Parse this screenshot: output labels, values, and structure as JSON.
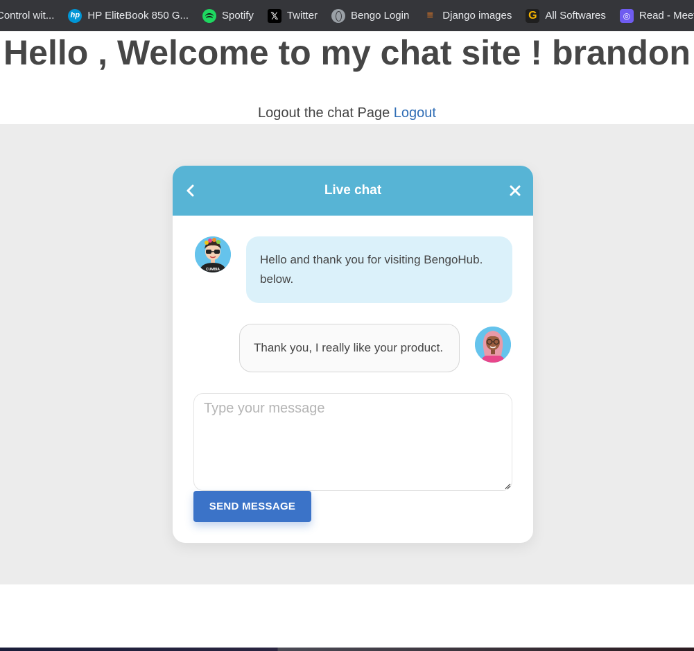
{
  "bookmarks": [
    {
      "label": "Control wit...",
      "icon": "none"
    },
    {
      "label": "HP EliteBook 850 G...",
      "icon": "hp-icon",
      "glyph": "hp"
    },
    {
      "label": "Spotify",
      "icon": "spotify-icon",
      "glyph": ""
    },
    {
      "label": "Twitter",
      "icon": "x-icon",
      "glyph": "𝕏"
    },
    {
      "label": "Bengo Login",
      "icon": "globe-icon",
      "glyph": ""
    },
    {
      "label": "Django images",
      "icon": "stackoverflow-icon",
      "glyph": "≡"
    },
    {
      "label": "All Softwares",
      "icon": "g-icon",
      "glyph": "G"
    },
    {
      "label": "Read - Meeting",
      "icon": "read-icon",
      "glyph": "◎"
    }
  ],
  "header": {
    "welcome": "Hello , Welcome to my chat site ! brandon",
    "logout_text": "Logout the chat Page",
    "logout_link": "Logout"
  },
  "chat": {
    "title": "Live chat",
    "messages": [
      {
        "from": "agent",
        "text": "Hello and thank you for visiting BengoHub. below."
      },
      {
        "from": "user",
        "text": "Thank you, I really like your product."
      }
    ],
    "input_placeholder": "Type your message",
    "send_label": "SEND MESSAGE"
  },
  "colors": {
    "header_bg": "#57b4d5",
    "send_button": "#3b73c8",
    "agent_bubble": "#dbf1fa",
    "user_bubble": "#fafafa",
    "link": "#2f6db5",
    "page_grey": "#ececec"
  }
}
